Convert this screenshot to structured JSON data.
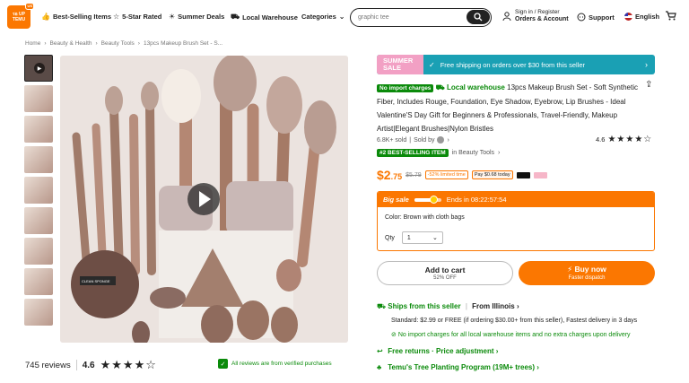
{
  "header": {
    "logo_line1": "รอ UP",
    "logo_line2": "TEMU",
    "logo_badge": "US",
    "nav": [
      {
        "label": "Best-Selling Items",
        "icon": "thumbs-up-icon"
      },
      {
        "label": "5-Star Rated",
        "icon": "star-badge-icon"
      },
      {
        "label": "Summer Deals",
        "icon": "sun-icon"
      },
      {
        "label": "Local Warehouse",
        "icon": "truck-icon"
      },
      {
        "label": "Categories",
        "icon": "chevron-down-icon"
      }
    ],
    "search_value": "graphic tee",
    "signin_line1": "Sign in / Register",
    "signin_line2": "Orders & Account",
    "support": "Support",
    "language": "English"
  },
  "breadcrumb": [
    "Home",
    "Beauty & Health",
    "Beauty Tools",
    "13pcs Makeup Brush Set - S..."
  ],
  "gallery": {
    "thumb_count": 10,
    "reviews_count": "745 reviews",
    "rating": "4.6",
    "rating_value": 4.6,
    "verified": "All reviews are from verified purchases",
    "image_label": "CLEAN SPONGE"
  },
  "banner": {
    "summer_line1": "SUMMER",
    "summer_line2": "SALE",
    "message": "Free shipping on orders over $30 from this seller"
  },
  "product": {
    "tag_no_import": "No import charges",
    "tag_local": "Local warehouse",
    "title": "13pcs Makeup Brush Set - Soft Synthetic Fiber, Includes Rouge, Foundation, Eye Shadow, Eyebrow, Lip Brushes - Ideal Valentine'S Day Gift for Beginners & Professionals, Travel-Friendly, Makeup Artist|Elegant Brushes|Nylon Bristles",
    "sold": "6.8K+ sold",
    "sold_by": "Sold by",
    "rating": "4.6",
    "best_tag": "#2 BEST-SELLING ITEM",
    "best_in": "in Beauty Tools",
    "price_dollar": "$2",
    "price_cents": ".75",
    "old_price": "$5.79",
    "discount": "-52% limited time",
    "pay_text": "Pay $0.68 today"
  },
  "sale": {
    "label": "Big sale",
    "ends": "Ends in 08:22:57:54",
    "progress": 0.7,
    "color_label": "Color: Brown with cloth bags",
    "qty_label": "Qty",
    "qty_value": "1"
  },
  "actions": {
    "cart_label": "Add to cart",
    "cart_sub": "52% OFF",
    "buy_label": "Buy now",
    "buy_sub": "Faster dispatch"
  },
  "shipping": {
    "ships_from": "Ships from this seller",
    "from_place": "From Illinois",
    "standard": "Standard: $2.99 or FREE (if ordering $30.00+ from this seller), Fastest delivery in 3 days",
    "no_import": "No import charges for all local warehouse items and no extra charges upon delivery",
    "free_returns": "Free returns · Price adjustment",
    "tree": "Temu's Tree Planting Program (19M+ trees)"
  }
}
